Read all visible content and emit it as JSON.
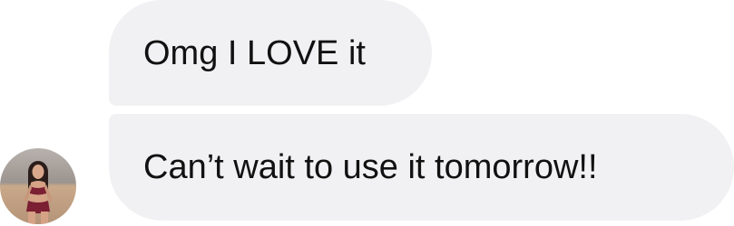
{
  "messages": [
    {
      "text": "Omg I LOVE it"
    },
    {
      "text": "Can’t wait to use it tomorrow!!"
    }
  ],
  "avatar": {
    "icon": "profile-photo"
  },
  "colors": {
    "bubble_bg": "#f1f1f3",
    "text": "#111111"
  }
}
